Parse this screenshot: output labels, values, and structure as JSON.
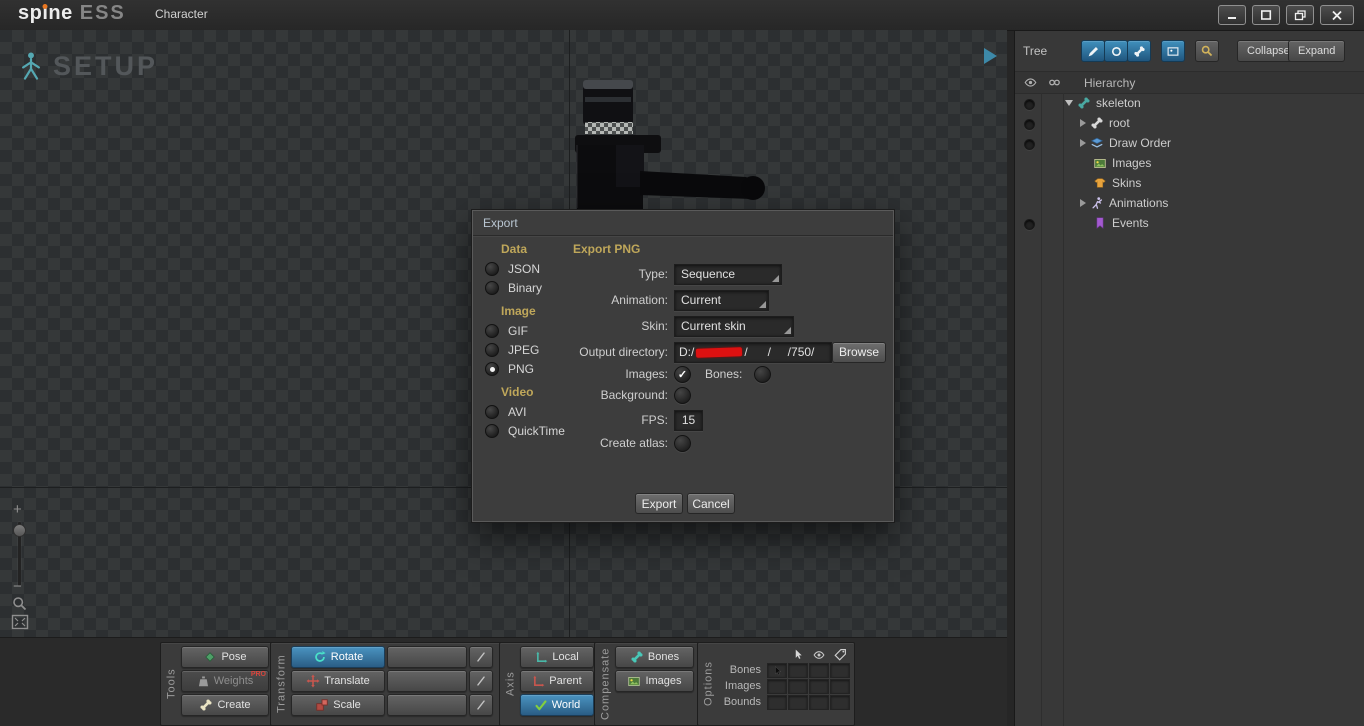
{
  "titlebar": {
    "logo_prefix": "sp",
    "logo_i": "ı",
    "logo_suffix": "ne",
    "edition": "ESS",
    "tab": "Character",
    "window_controls": [
      "minimize",
      "maximize",
      "restore",
      "close"
    ]
  },
  "canvas": {
    "mode": "SETUP"
  },
  "zoom": {
    "plus": "+",
    "minus": "−"
  },
  "dialog": {
    "title": "Export",
    "format": {
      "data_header": "Data",
      "json": "JSON",
      "binary": "Binary",
      "image_header": "Image",
      "gif": "GIF",
      "jpeg": "JPEG",
      "png": "PNG",
      "video_header": "Video",
      "avi": "AVI",
      "quicktime": "QuickTime",
      "selected": "PNG"
    },
    "panel": {
      "header": "Export PNG",
      "type_label": "Type:",
      "type_value": "Sequence",
      "animation_label": "Animation:",
      "animation_value": "Current",
      "skin_label": "Skin:",
      "skin_value": "Current skin",
      "output_label": "Output directory:",
      "output_prefix": "D:/",
      "output_redacted": true,
      "output_suffix": "/      /     /750/",
      "browse": "Browse",
      "images_label": "Images:",
      "images_checked": true,
      "bones_label": "Bones:",
      "bones_checked": false,
      "background_label": "Background:",
      "background_checked": false,
      "fps_label": "FPS:",
      "fps_value": "15",
      "atlas_label": "Create atlas:",
      "atlas_checked": false,
      "check_glyph": "✓",
      "export_button": "Export",
      "cancel_button": "Cancel"
    }
  },
  "tree": {
    "title": "Tree",
    "collapse_button": "Collapse",
    "expand_button": "Expand",
    "hierarchy_header": "Hierarchy",
    "items": [
      {
        "label": "skeleton",
        "icon": "bone-teal",
        "expanded": true
      },
      {
        "label": "root",
        "icon": "bone",
        "expanded": false
      },
      {
        "label": "Draw Order",
        "icon": "draw-order",
        "expanded": false
      },
      {
        "label": "Images",
        "icon": "images-folder",
        "expanded": false
      },
      {
        "label": "Skins",
        "icon": "skins",
        "expanded": false
      },
      {
        "label": "Animations",
        "icon": "animations",
        "expanded": false
      },
      {
        "label": "Events",
        "icon": "events",
        "expanded": false
      }
    ]
  },
  "toolbar": {
    "tools": {
      "label": "Tools",
      "pose": "Pose",
      "weights": "Weights",
      "weights_badge": "PRO",
      "create": "Create"
    },
    "transform": {
      "label": "Transform",
      "rotate": "Rotate",
      "translate": "Translate",
      "scale": "Scale",
      "selected": "Rotate"
    },
    "axis": {
      "label": "Axis",
      "local": "Local",
      "parent": "Parent",
      "world": "World",
      "selected": "World"
    },
    "compensate": {
      "label": "Compensate",
      "bones": "Bones",
      "images": "Images"
    },
    "options": {
      "label": "Options",
      "rows": [
        "Bones",
        "Images",
        "Bounds"
      ],
      "columns": [
        "select",
        "visible",
        "name"
      ]
    }
  },
  "colors": {
    "selection_blue": "#35789f",
    "panel_button_blue": "#4090bd",
    "header_gold": "#bfa75a",
    "logo_orange": "#e87722",
    "redaction_red": "#dd1111",
    "check_green": "#82cf3f",
    "teal_icon": "#49c8b8",
    "red_icon": "#c8564e"
  }
}
